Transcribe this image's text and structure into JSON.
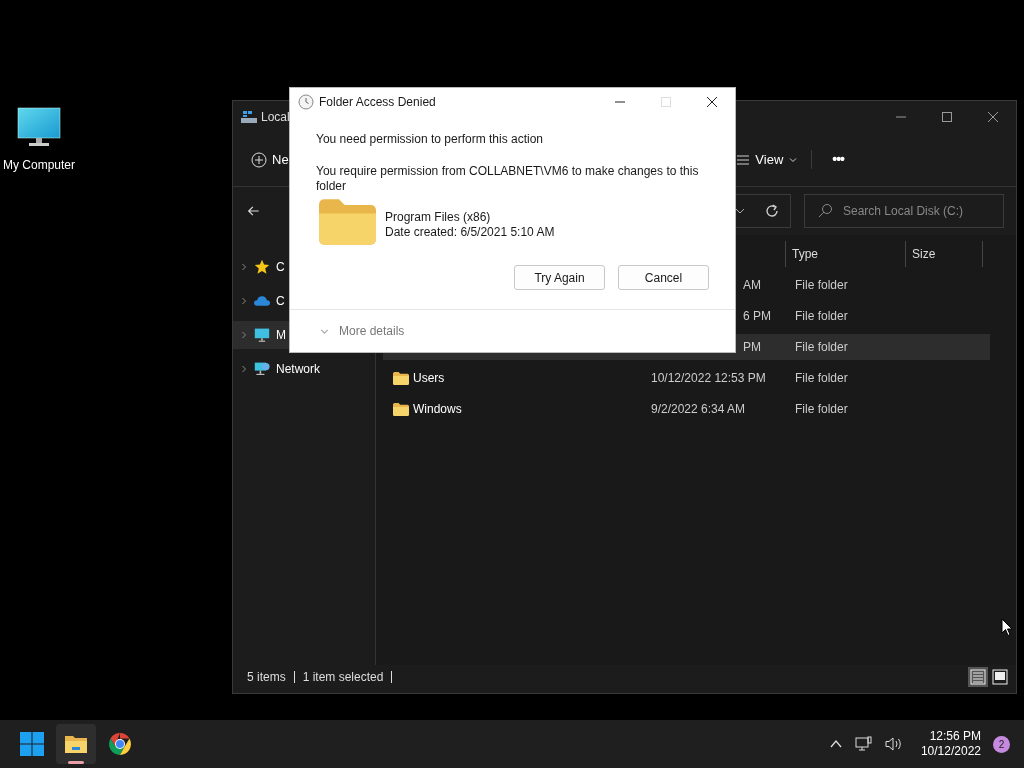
{
  "desktop": {
    "icons": [
      {
        "label": "My Computer"
      }
    ]
  },
  "explorer": {
    "title": "Local",
    "toolbar": {
      "new_label": "Ne",
      "view_label": "View",
      "more_label": "•••"
    },
    "search": {
      "placeholder": "Search Local Disk (C:)"
    },
    "sidebar": {
      "items": [
        {
          "kind": "star",
          "label": "C",
          "selected": false
        },
        {
          "kind": "cloud",
          "label": "C",
          "selected": false
        },
        {
          "kind": "computer",
          "label": "M",
          "selected": true
        },
        {
          "kind": "network",
          "label": "Network",
          "selected": false
        }
      ]
    },
    "columns": {
      "type": "Type",
      "size": "Size"
    },
    "rows": [
      {
        "date": "AM",
        "type": "File folder",
        "selected": false
      },
      {
        "date": "6 PM",
        "type": "File folder",
        "selected": false
      },
      {
        "date": "PM",
        "type": "File folder",
        "selected": true
      },
      {
        "name": "Users",
        "date": "10/12/2022 12:53 PM",
        "type": "File folder",
        "selected": false
      },
      {
        "name": "Windows",
        "date": "9/2/2022 6:34 AM",
        "type": "File folder",
        "selected": false
      }
    ],
    "status_bar": {
      "count": "5 items",
      "selection": "1 item selected",
      "view_buttons": [
        {
          "kind": "details",
          "selected": true
        },
        {
          "kind": "tiles",
          "selected": false
        }
      ]
    }
  },
  "dialog": {
    "title": "Folder Access Denied",
    "message": "You need permission to perform this action",
    "detail": "You require permission from COLLABNET\\VM6 to make changes to this folder",
    "item": {
      "name": "Program Files (x86)",
      "date": "Date created: 6/5/2021 5:10 AM"
    },
    "buttons": [
      "Try Again",
      "Cancel"
    ],
    "more_details": "More details",
    "maximize_disabled": true
  },
  "taskbar": {
    "apps": [
      {
        "kind": "start",
        "selected": false
      },
      {
        "kind": "explorer",
        "selected": true
      },
      {
        "kind": "chrome",
        "selected": false
      }
    ],
    "time": "12:56 PM",
    "date": "10/12/2022",
    "notifications": "2"
  }
}
